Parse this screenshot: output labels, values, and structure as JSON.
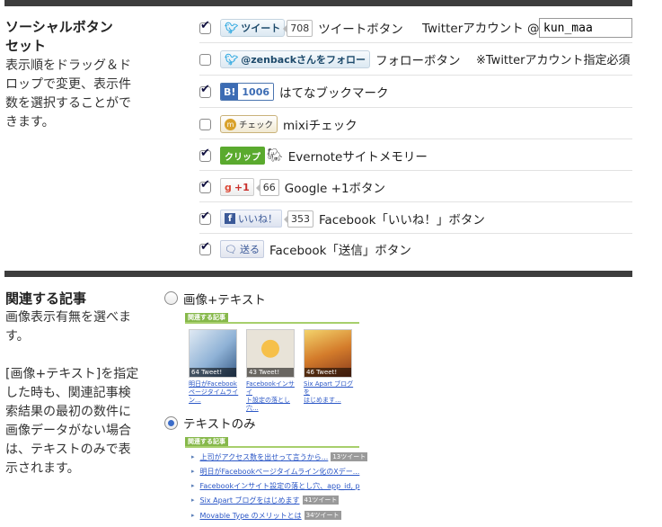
{
  "social": {
    "title_line1": "ソーシャルボタン",
    "title_line2": "セット",
    "desc_lines": [
      "表示順をドラッグ＆ド",
      "ロップで変更、表示件",
      "数を選択することがで",
      "きます。"
    ],
    "twitter_account_label": "Twitterアカウント @",
    "twitter_account_value": "kun_maa",
    "twitter_note": "※Twitterアカウント指定必須",
    "items": [
      {
        "checked": true,
        "btn": "ツイート",
        "count": "708",
        "label": "ツイートボタン"
      },
      {
        "checked": false,
        "btn": "@zenbackさんをフォロー",
        "label": "フォローボタン"
      },
      {
        "checked": true,
        "btn_icon": "B!",
        "btn": "1006",
        "label": "はてなブックマーク"
      },
      {
        "checked": false,
        "btn": "チェック",
        "label": "mixiチェック"
      },
      {
        "checked": true,
        "btn": "クリップ",
        "label": "Evernoteサイトメモリー"
      },
      {
        "checked": true,
        "btn": "+1",
        "count": "66",
        "label": "Google +1ボタン"
      },
      {
        "checked": true,
        "btn": "いいね！",
        "count": "353",
        "label": "Facebook「いいね！」ボタン"
      },
      {
        "checked": true,
        "btn": "送る",
        "label": "Facebook「送信」ボタン"
      }
    ]
  },
  "related": {
    "title": "関連する記事",
    "desc_lines_a": [
      "画像表示有無を選べま",
      "す。"
    ],
    "desc_lines_b": [
      "[画像+テキスト]を指定",
      "した時も、関連記事検",
      "索結果の最初の数件に",
      "画像データがない場合",
      "は、テキストのみで表",
      "示されます。"
    ],
    "option_image": "画像+テキスト",
    "option_text": "テキストのみ",
    "selected": "text",
    "preview_header": "関連する記事",
    "thumbs": [
      {
        "caption": "64 Tweet!",
        "link_lines": [
          "明日がFacebook",
          "ページタイムライン..."
        ]
      },
      {
        "caption": "43 Tweet!",
        "link_lines": [
          "Facebookインサイ",
          "ト設定の落とし穴..."
        ]
      },
      {
        "caption": "46 Tweet!",
        "link_lines": [
          "Six Apart ブログを",
          "はじめます..."
        ]
      }
    ],
    "text_list": [
      {
        "text": "上司がアクセス数を出せって言うから...",
        "badge": "13ツイート"
      },
      {
        "text": "明日がFacebookページタイムライン化のXデー...",
        "badge": ""
      },
      {
        "text": "Facebookインサイト設定の落とし穴、app_id, p",
        "badge": ""
      },
      {
        "text": "Six Apart ブログをはじめます",
        "badge": "41ツイート"
      },
      {
        "text": "Movable Type のメリットとは",
        "badge": "34ツイート"
      }
    ]
  }
}
